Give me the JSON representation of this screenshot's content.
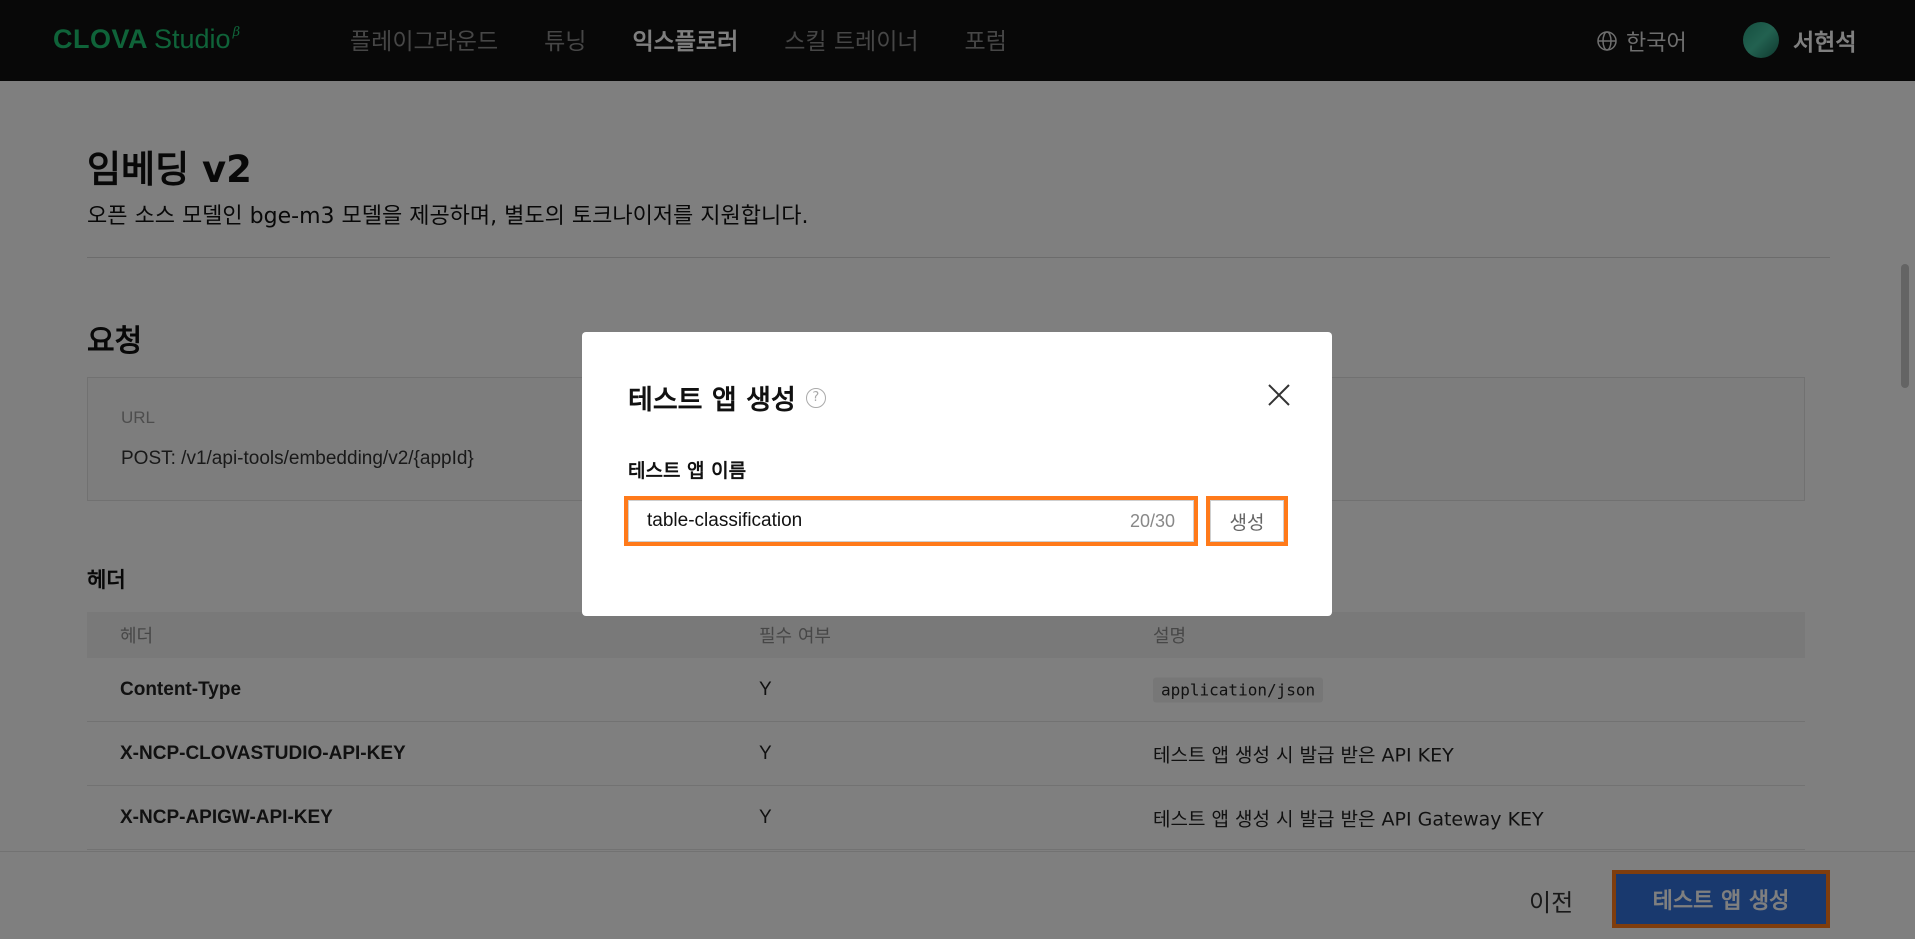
{
  "nav": {
    "logo_clova": "CLOVA",
    "logo_studio": "Studio",
    "logo_beta": "β",
    "items": [
      "플레이그라운드",
      "튜닝",
      "익스플로러",
      "스킬 트레이너",
      "포럼"
    ],
    "active_index": 2,
    "language": "한국어",
    "username": "서현석"
  },
  "page": {
    "title": "임베딩 v2",
    "description": "오픈 소스 모델인 bge-m3 모델을 제공하며, 별도의 토크나이저를 지원합니다.",
    "request_section": "요청",
    "url_label": "URL",
    "url_value": "POST: /v1/api-tools/embedding/v2/{appId}",
    "header_section": "헤더",
    "table": {
      "columns": [
        "헤더",
        "필수 여부",
        "설명"
      ],
      "rows": [
        {
          "header": "Content-Type",
          "required": "Y",
          "desc": "application/json"
        },
        {
          "header": "X-NCP-CLOVASTUDIO-API-KEY",
          "required": "Y",
          "desc": "테스트 앱 생성 시 발급 받은 API KEY"
        },
        {
          "header": "X-NCP-APIGW-API-KEY",
          "required": "Y",
          "desc": "테스트 앱 생성 시 발급 받은 API Gateway KEY"
        }
      ]
    }
  },
  "footer": {
    "prev_label": "이전",
    "primary_label": "테스트 앱 생성"
  },
  "modal": {
    "title": "테스트 앱 생성",
    "help_glyph": "?",
    "field_label": "테스트 앱 이름",
    "input_value": "table-classification",
    "counter": "20/30",
    "create_label": "생성"
  },
  "colors": {
    "brand": "#1ec773",
    "primary": "#3273dc",
    "highlight": "#ff7a1a"
  }
}
